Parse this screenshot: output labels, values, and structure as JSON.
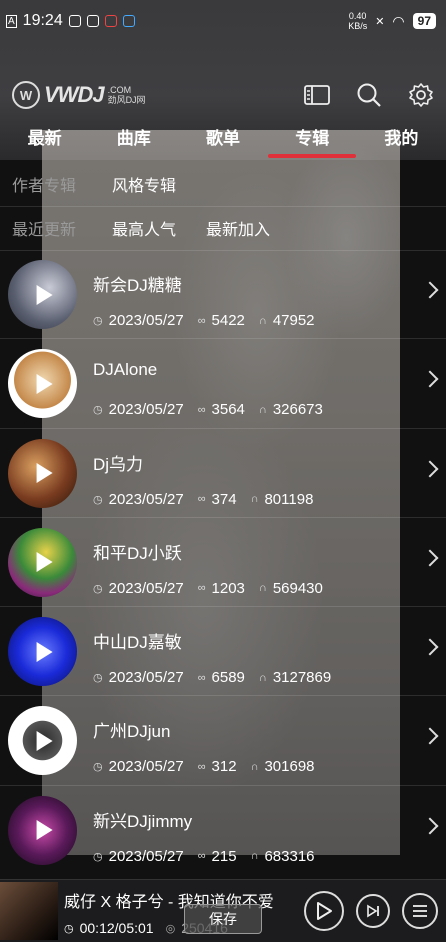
{
  "status_bar": {
    "time": "19:24",
    "speed_value": "0.40",
    "speed_unit": "KB/s",
    "battery": "97"
  },
  "header": {
    "logo_text": "VWDJ",
    "logo_suffix": ".COM",
    "logo_sub": "劲风DJ网"
  },
  "tabs": [
    {
      "label": "最新"
    },
    {
      "label": "曲库"
    },
    {
      "label": "歌单"
    },
    {
      "label": "专辑"
    },
    {
      "label": "我的"
    }
  ],
  "filters": {
    "category_label": "作者专辑",
    "category_option": "风格专辑",
    "sort_label": "最近更新",
    "sort_options": [
      "最高人气",
      "最新加入"
    ]
  },
  "albums": [
    {
      "name": "新会DJ糖糖",
      "date": "2023/05/27",
      "links": "5422",
      "plays": "47952"
    },
    {
      "name": "DJAlone",
      "date": "2023/05/27",
      "links": "3564",
      "plays": "326673"
    },
    {
      "name": "Dj乌力",
      "date": "2023/05/27",
      "links": "374",
      "plays": "801198"
    },
    {
      "name": "和平DJ小跃",
      "date": "2023/05/27",
      "links": "1203",
      "plays": "569430"
    },
    {
      "name": "中山DJ嘉敏",
      "date": "2023/05/27",
      "links": "6589",
      "plays": "3127869"
    },
    {
      "name": "广州DJjun",
      "date": "2023/05/27",
      "links": "312",
      "plays": "301698"
    },
    {
      "name": "新兴DJjimmy",
      "date": "2023/05/27",
      "links": "215",
      "plays": "683316"
    }
  ],
  "player": {
    "title": "威仔 X 格子兮 - 我知道你不爱",
    "time": "00:12/05:01",
    "plays": "250416",
    "save_label": "保存"
  }
}
